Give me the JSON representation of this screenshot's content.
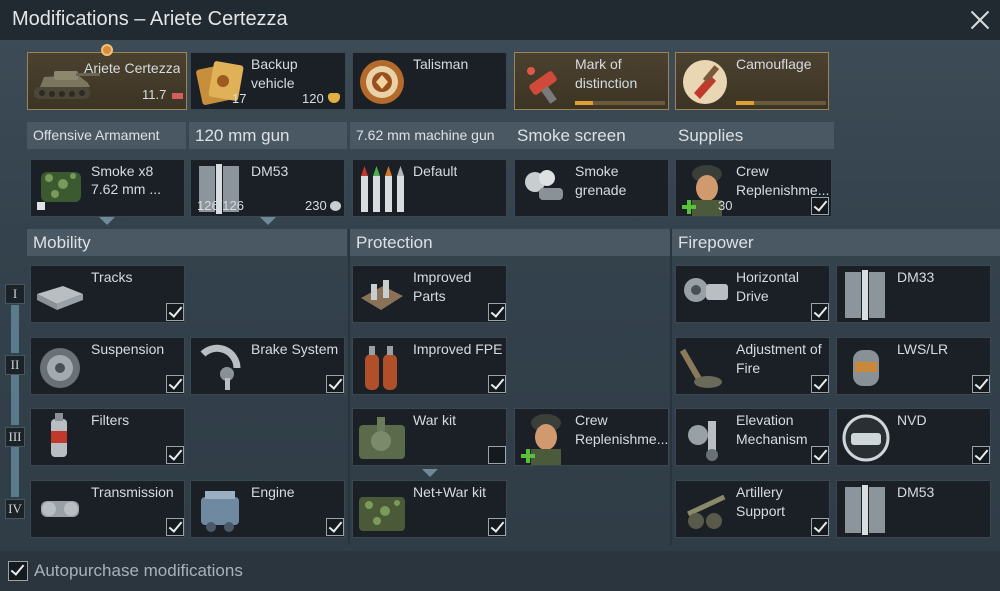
{
  "window": {
    "title": "Modifications – Ariete Certezza",
    "close_icon": "close-icon"
  },
  "vehicle": {
    "name": "Ariete Certezza",
    "br": "11.7"
  },
  "top_cards": [
    {
      "title": "Backup vehicle",
      "left_count": "17",
      "right_count": "120",
      "icon": "backup-vehicle-icon"
    },
    {
      "title": "Talisman",
      "icon": "talisman-icon"
    },
    {
      "title": "Mark of distinction",
      "icon": "mark-of-distinction-icon",
      "progress": 0.1
    },
    {
      "title": "Camouflage",
      "icon": "camouflage-brush-icon",
      "progress": 0.1
    }
  ],
  "columns": [
    {
      "header": "Offensive Armament",
      "card": {
        "title": "Smoke x8",
        "subtitle": "7.62 mm ...",
        "icon": "smoke-ammo-icon"
      }
    },
    {
      "header": "120 mm gun",
      "card": {
        "title": "DM53",
        "ammo": "126/126",
        "cost": "230",
        "icon": "dm53-shell-icon"
      }
    },
    {
      "header": "7.62 mm machine gun",
      "card": {
        "title": "Default",
        "icon": "mg-belt-icon"
      }
    },
    {
      "header": "Smoke screen",
      "card": {
        "title": "Smoke grenade",
        "icon": "smoke-grenade-icon"
      }
    },
    {
      "header": "Supplies",
      "card": {
        "title": "Crew Replenishme...",
        "count": "30",
        "icon": "crew-replenishment-icon",
        "checked": true
      }
    }
  ],
  "sections": {
    "mobility": "Mobility",
    "protection": "Protection",
    "firepower": "Firepower"
  },
  "tiers": [
    "I",
    "II",
    "III",
    "IV"
  ],
  "mobility": [
    {
      "title": "Tracks",
      "icon": "tracks-icon",
      "checked": true
    },
    {
      "title": "Suspension",
      "icon": "suspension-icon",
      "checked": true
    },
    {
      "title": "Brake System",
      "icon": "brake-system-icon",
      "checked": true
    },
    {
      "title": "Filters",
      "icon": "filters-icon",
      "checked": true
    },
    {
      "title": "Transmission",
      "icon": "transmission-icon",
      "checked": true
    },
    {
      "title": "Engine",
      "icon": "engine-icon",
      "checked": true
    }
  ],
  "protection": [
    {
      "title": "Improved Parts",
      "icon": "improved-parts-icon",
      "checked": true
    },
    {
      "title": "Improved FPE",
      "icon": "improved-fpe-icon",
      "checked": true
    },
    {
      "title": "War kit",
      "icon": "war-kit-icon",
      "checked": false
    },
    {
      "title": "Crew Replenishme...",
      "icon": "crew-replenishment-icon",
      "checked": false
    },
    {
      "title": "Net+War kit",
      "icon": "net-war-kit-icon",
      "checked": true
    }
  ],
  "firepower": [
    {
      "title": "Horizontal Drive",
      "icon": "horizontal-drive-icon",
      "checked": true
    },
    {
      "title": "DM33",
      "icon": "dm33-shell-icon",
      "checked": false
    },
    {
      "title": "Adjustment of Fire",
      "icon": "adjustment-of-fire-icon",
      "checked": true
    },
    {
      "title": "LWS/LR",
      "icon": "lws-lr-icon",
      "checked": true
    },
    {
      "title": "Elevation Mechanism",
      "icon": "elevation-mechanism-icon",
      "checked": true
    },
    {
      "title": "NVD",
      "icon": "nvd-icon",
      "checked": true
    },
    {
      "title": "Artillery Support",
      "icon": "artillery-support-icon",
      "checked": true
    },
    {
      "title": "DM53",
      "icon": "dm53-shell-icon",
      "checked": false
    }
  ],
  "footer": {
    "autopurchase_label": "Autopurchase modifications",
    "autopurchase_checked": true
  },
  "colors": {
    "accent_gold": "#e0a030",
    "header_bg": "#4a5864",
    "card_bg": "#1a2026"
  }
}
